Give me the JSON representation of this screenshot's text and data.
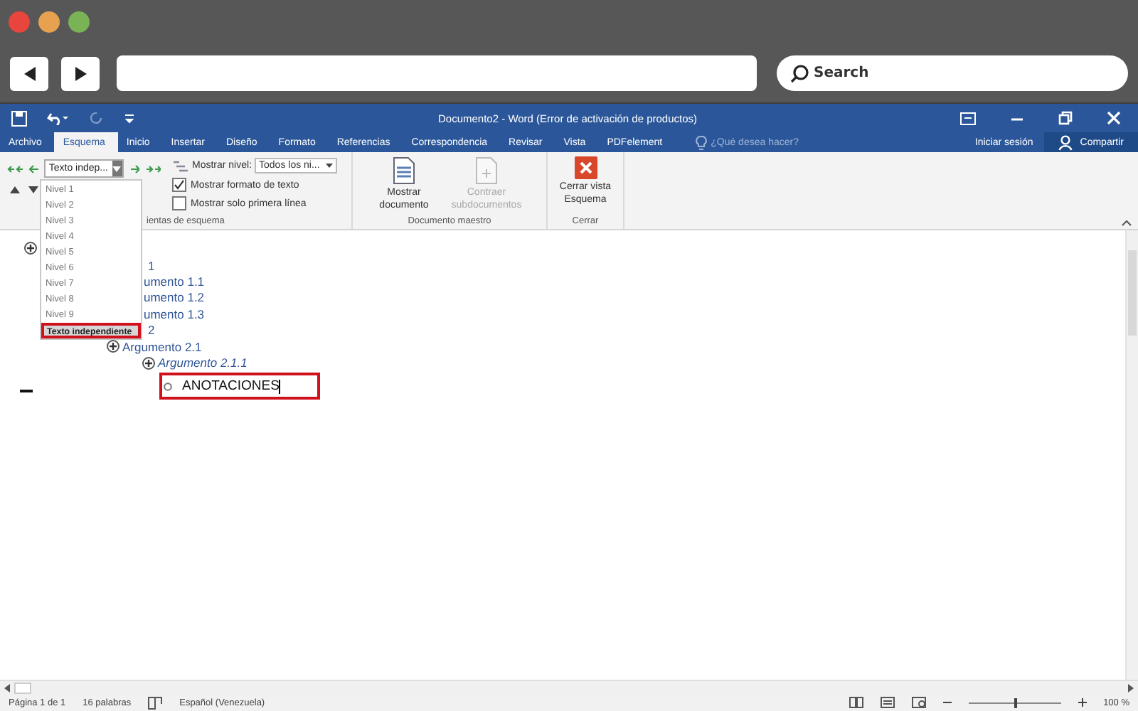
{
  "browser": {
    "search": {
      "placeholder": "Search"
    }
  },
  "window": {
    "title": "Documento2 - Word (Error de activación de productos)"
  },
  "tabs": [
    {
      "label": "Archivo",
      "selected": false
    },
    {
      "label": "Esquema",
      "selected": true
    },
    {
      "label": "Inicio",
      "selected": false
    },
    {
      "label": "Insertar",
      "selected": false
    },
    {
      "label": "Diseño",
      "selected": false
    },
    {
      "label": "Formato",
      "selected": false
    },
    {
      "label": "Referencias",
      "selected": false
    },
    {
      "label": "Correspondencia",
      "selected": false
    },
    {
      "label": "Revisar",
      "selected": false
    },
    {
      "label": "Vista",
      "selected": false
    },
    {
      "label": "PDFelement",
      "selected": false
    }
  ],
  "tell_me": {
    "placeholder": "¿Qué desea hacer?"
  },
  "sign_in": "Iniciar sesión",
  "share": "Compartir",
  "ribbon": {
    "level_combo": "Texto indep...",
    "show_level_label": "Mostrar nivel:",
    "show_level_combo": "Todos los ni...",
    "checks": [
      {
        "label": "Mostrar formato de texto",
        "checked": true
      },
      {
        "label": "Mostrar solo primera línea",
        "checked": false
      }
    ],
    "group_outline": "ientas de esquema",
    "master_buttons": [
      {
        "label": "Mostrar documento",
        "disabled": false
      },
      {
        "label": "Contraer subdocumentos",
        "disabled": true
      }
    ],
    "group_master": "Documento maestro",
    "close_button": "Cerrar vista Esquema",
    "group_close": "Cerrar"
  },
  "level_menu": [
    {
      "label": "Nivel 1",
      "selected": false
    },
    {
      "label": "Nivel 2",
      "selected": false
    },
    {
      "label": "Nivel 3",
      "selected": false
    },
    {
      "label": "Nivel 4",
      "selected": false
    },
    {
      "label": "Nivel 5",
      "selected": false
    },
    {
      "label": "Nivel 6",
      "selected": false
    },
    {
      "label": "Nivel 7",
      "selected": false
    },
    {
      "label": "Nivel 8",
      "selected": false
    },
    {
      "label": "Nivel 9",
      "selected": false
    },
    {
      "label": "Texto independiente",
      "selected": true
    }
  ],
  "outline": [
    {
      "expandable": true,
      "children": [
        {
          "text": "1",
          "children": [
            {
              "text": "umento 1.1"
            },
            {
              "text": "umento 1.2"
            },
            {
              "text": "umento 1.3"
            }
          ]
        },
        {
          "text": "2",
          "children": [
            {
              "text": "Argumento 2.1",
              "expandable": true,
              "children": [
                {
                  "text": "Argumento 2.1.1",
                  "expandable": true,
                  "italic": true,
                  "children": [
                    {
                      "text": "ANOTACIONES",
                      "kind": "body",
                      "marked": true
                    }
                  ]
                }
              ]
            }
          ]
        }
      ]
    }
  ],
  "status_bar": {
    "page": "Página 1 de 1",
    "words": "16 palabras",
    "language": "Español (Venezuela)",
    "zoom": "100 %",
    "level": 0.5
  }
}
